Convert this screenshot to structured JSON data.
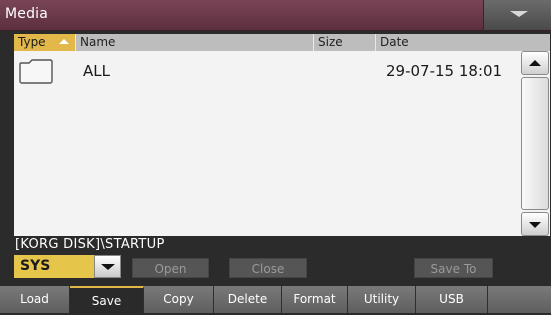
{
  "window": {
    "title": "Media"
  },
  "header": {
    "columns": {
      "type": "Type",
      "name": "Name",
      "size": "Size",
      "date": "Date"
    },
    "sort_icon": "sort-up-icon"
  },
  "list": {
    "rows": [
      {
        "icon": "folder-icon",
        "name": "ALL",
        "size": "",
        "date": "29-07-15 18:01"
      }
    ]
  },
  "path": "[KORG DISK]\\STARTUP",
  "device": {
    "selected": "SYS"
  },
  "buttons": {
    "open": "Open",
    "close": "Close",
    "save_to": "Save To"
  },
  "tabs": [
    {
      "label": "Load",
      "active": false
    },
    {
      "label": "Save",
      "active": true
    },
    {
      "label": "Copy",
      "active": false
    },
    {
      "label": "Delete",
      "active": false
    },
    {
      "label": "Format",
      "active": false
    },
    {
      "label": "Utility",
      "active": false
    },
    {
      "label": "USB",
      "active": false
    }
  ],
  "colors": {
    "title_bar": "#6b3a4a",
    "accent": "#e2b84a",
    "panel": "#f3f3f3"
  }
}
